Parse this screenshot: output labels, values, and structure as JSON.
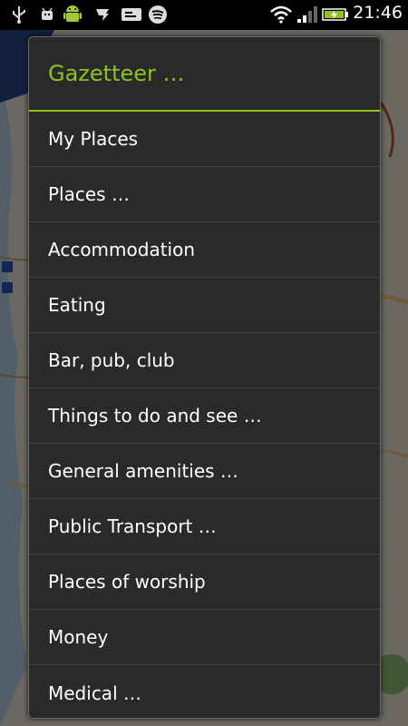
{
  "status_bar": {
    "time": "21:46",
    "icons": [
      "usb-icon",
      "android-debug-icon",
      "android-robot-icon",
      "app-notification-icon",
      "message-icon",
      "spotify-icon",
      "wifi-icon",
      "signal-icon",
      "battery-charging-icon"
    ]
  },
  "dialog": {
    "title": "Gazetteer …",
    "items": [
      {
        "label": "My Places"
      },
      {
        "label": "Places …"
      },
      {
        "label": "Accommodation"
      },
      {
        "label": "Eating"
      },
      {
        "label": "Bar, pub, club"
      },
      {
        "label": "Things to do and see …"
      },
      {
        "label": "General amenities …"
      },
      {
        "label": "Public Transport …"
      },
      {
        "label": "Places of worship"
      },
      {
        "label": "Money"
      },
      {
        "label": "Medical …"
      }
    ]
  },
  "colors": {
    "accent": "#8fc21f",
    "dialog_bg": "#2a2a2a",
    "divider": "#404040"
  }
}
